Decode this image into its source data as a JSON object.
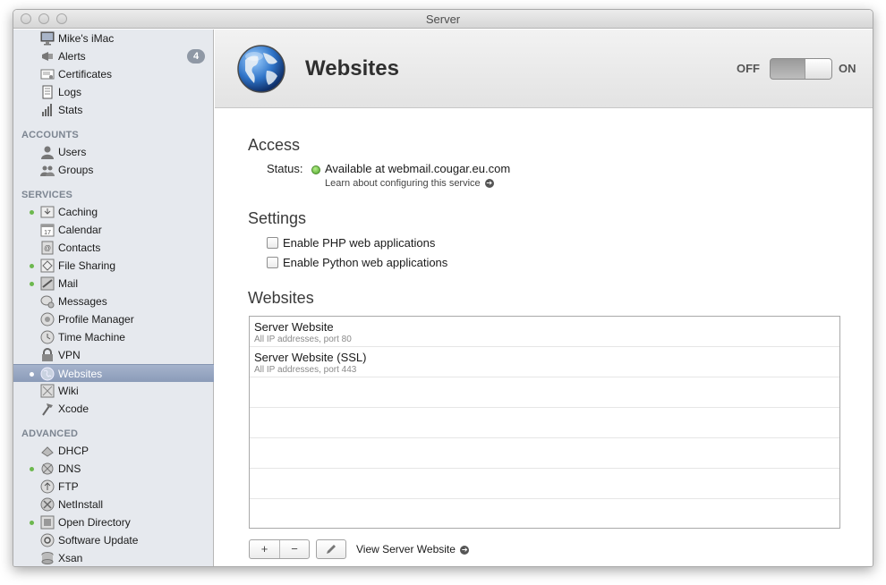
{
  "window": {
    "title": "Server"
  },
  "sidebar": {
    "items": [
      {
        "key": "macs",
        "label": "Mike's iMac",
        "icon": "imac-icon",
        "top": 0
      },
      {
        "key": "alerts",
        "label": "Alerts",
        "icon": "megaphone-icon",
        "badge": "4"
      },
      {
        "key": "certificates",
        "label": "Certificates",
        "icon": "certificate-icon"
      },
      {
        "key": "logs",
        "label": "Logs",
        "icon": "log-icon"
      },
      {
        "key": "stats",
        "label": "Stats",
        "icon": "stats-icon"
      }
    ],
    "accounts_header": "ACCOUNTS",
    "accounts": [
      {
        "label": "Users",
        "icon": "user-icon"
      },
      {
        "label": "Groups",
        "icon": "group-icon"
      }
    ],
    "services_header": "SERVICES",
    "services": [
      {
        "label": "Caching",
        "icon": "caching-icon",
        "running": true
      },
      {
        "label": "Calendar",
        "icon": "calendar-icon",
        "running": false
      },
      {
        "label": "Contacts",
        "icon": "contacts-icon",
        "running": false
      },
      {
        "label": "File Sharing",
        "icon": "file-sharing-icon",
        "running": true
      },
      {
        "label": "Mail",
        "icon": "mail-icon",
        "running": true
      },
      {
        "label": "Messages",
        "icon": "messages-icon",
        "running": false
      },
      {
        "label": "Profile Manager",
        "icon": "profile-manager-icon",
        "running": false
      },
      {
        "label": "Time Machine",
        "icon": "time-machine-icon",
        "running": false
      },
      {
        "label": "VPN",
        "icon": "lock-icon",
        "running": false
      },
      {
        "label": "Websites",
        "icon": "globe-icon",
        "running": true,
        "selected": true
      },
      {
        "label": "Wiki",
        "icon": "wiki-icon",
        "running": false
      },
      {
        "label": "Xcode",
        "icon": "hammer-icon",
        "running": false
      }
    ],
    "advanced_header": "ADVANCED",
    "advanced": [
      {
        "label": "DHCP",
        "icon": "dhcp-icon",
        "running": false
      },
      {
        "label": "DNS",
        "icon": "dns-icon",
        "running": true
      },
      {
        "label": "FTP",
        "icon": "ftp-icon",
        "running": false
      },
      {
        "label": "NetInstall",
        "icon": "netinstall-icon",
        "running": false
      },
      {
        "label": "Open Directory",
        "icon": "open-directory-icon",
        "running": true
      },
      {
        "label": "Software Update",
        "icon": "software-update-icon",
        "running": false
      },
      {
        "label": "Xsan",
        "icon": "xsan-icon",
        "running": false
      }
    ]
  },
  "header": {
    "title": "Websites",
    "icon": "globe-icon",
    "toggle_off": "OFF",
    "toggle_on": "ON",
    "toggle_state": "on"
  },
  "access": {
    "title": "Access",
    "status_label": "Status:",
    "status_text": "Available at webmail.cougar.eu.com",
    "learn_link": "Learn about configuring this service",
    "status_color": "#5ab233"
  },
  "settings": {
    "title": "Settings",
    "php_label": "Enable PHP web applications",
    "php_checked": false,
    "python_label": "Enable Python web applications",
    "python_checked": false
  },
  "websites": {
    "title": "Websites",
    "rows": [
      {
        "title": "Server Website",
        "subtitle": "All IP addresses, port 80"
      },
      {
        "title": "Server Website (SSL)",
        "subtitle": "All IP addresses, port 443"
      }
    ],
    "add_label": "+",
    "remove_label": "−",
    "edit_icon": "pencil-icon",
    "view_link": "View Server Website"
  }
}
